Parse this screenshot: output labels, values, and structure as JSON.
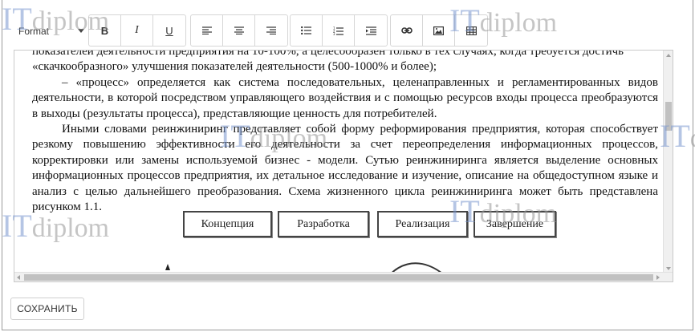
{
  "toolbar": {
    "format_label": "Format",
    "bold": "B",
    "italic": "I",
    "underline": "U",
    "icons": [
      "align-left-icon",
      "align-center-icon",
      "align-right-icon",
      "bulleted-list-icon",
      "numbered-list-icon",
      "indent-icon",
      "link-icon",
      "image-icon",
      "table-icon"
    ]
  },
  "content": {
    "line1": "показателей деятельности предприятия на 10-100%, а целесообразен только в тех случаях, когда требуется достичь",
    "line2": "«скачкообразного» улучшения показателей деятельности (500-1000% и более);",
    "para2": "– «процесс» определяется как система последовательных, целенаправленных и регламентированных видов деятельности, в которой посредством управляющего воздействия и с помощью ресурсов входы процесса преобразуются в выходы (результаты процесса), представляющие ценность для потребителей.",
    "para3": "Иными словами реинжиниринг представляет собой форму реформирования предприятия, которая способствует резкому повышению эффективности его деятельности за счет переопределения информационных процессов, корректировки или замены используемой бизнес - модели. Сутью реинжиниринга является выделение основных информационных процессов предприятия, их детальное исследование и изучение, описание на общедоступном языке и анализ с целью дальнейшего преобразования. Схема жизненного цикла реинжиниринга может быть представлена рисунком 1.1."
  },
  "diagram": {
    "boxes": [
      "Концепция",
      "Разработка",
      "Реализация",
      "Завершение"
    ]
  },
  "save_button": "СОХРАНИТЬ",
  "watermark": {
    "it": "IT",
    "diplom": "diplom"
  }
}
